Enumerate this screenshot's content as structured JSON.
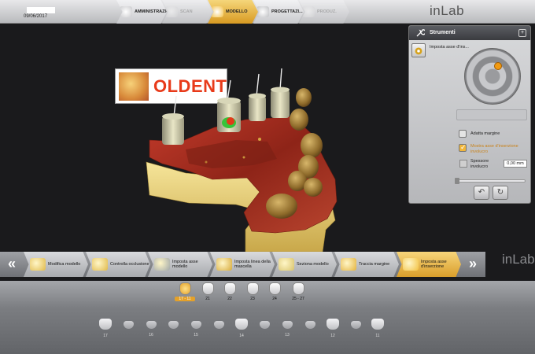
{
  "header": {
    "date": "09/06/2017",
    "brand": "inLab",
    "workflow": [
      {
        "label": "AMMINISTRAZIONE",
        "icon": "patient-record-icon",
        "state": "normal"
      },
      {
        "label": "SCAN",
        "icon": "scanner-icon",
        "state": "dim"
      },
      {
        "label": "MODELLO",
        "icon": "model-icon",
        "state": "active"
      },
      {
        "label": "PROGETTAZI...",
        "icon": "design-icon",
        "state": "normal"
      },
      {
        "label": "PRODUZ.",
        "icon": "milling-icon",
        "state": "dim"
      }
    ]
  },
  "scene": {
    "logo_text": "OLDENT"
  },
  "tools_panel": {
    "title": "Strumenti",
    "close_label": "+",
    "active_tool": "Imposta asse d'ins...",
    "disabled_button": "",
    "options": {
      "adapt_margin": {
        "label": "Adatta margine",
        "checked": false
      },
      "show_insertion_axis": {
        "label": "Mostra asse d'inserzione involucro",
        "checked": true
      }
    },
    "thickness_label": "Spessore involucro",
    "thickness_value": "0,00 mm",
    "undo_symbol": "↶",
    "redo_symbol": "↻"
  },
  "step_bar": {
    "prev": "«",
    "next": "»",
    "brand": "inLab",
    "steps": [
      {
        "label": "Modifica modello",
        "icon": "edit-model-icon",
        "active": false
      },
      {
        "label": "Controlla occlusione",
        "icon": "occlusion-icon",
        "active": false
      },
      {
        "label": "Imposta asse modello",
        "icon": "model-axis-icon",
        "active": false
      },
      {
        "label": "Imposta linea della mascella",
        "icon": "jaw-line-icon",
        "active": false
      },
      {
        "label": "Seziona modello",
        "icon": "section-model-icon",
        "active": false
      },
      {
        "label": "Traccia margine",
        "icon": "trace-margin-icon",
        "active": false
      },
      {
        "label": "Imposta asse d'inserzione",
        "icon": "insertion-axis-icon",
        "active": true
      }
    ]
  },
  "tooth_bar": [
    {
      "label": "17 - 11",
      "selected": true
    },
    {
      "label": "21",
      "selected": false
    },
    {
      "label": "22",
      "selected": false
    },
    {
      "label": "23",
      "selected": false
    },
    {
      "label": "24",
      "selected": false
    },
    {
      "label": "25 - 27",
      "selected": false
    }
  ],
  "arch_teeth": [
    {
      "label": "17",
      "type": "crown"
    },
    {
      "label": "",
      "type": "link"
    },
    {
      "label": "16",
      "type": "link"
    },
    {
      "label": "",
      "type": "link"
    },
    {
      "label": "15",
      "type": "link"
    },
    {
      "label": "",
      "type": "link"
    },
    {
      "label": "14",
      "type": "crown"
    },
    {
      "label": "",
      "type": "link"
    },
    {
      "label": "13",
      "type": "link"
    },
    {
      "label": "",
      "type": "link"
    },
    {
      "label": "12",
      "type": "crown"
    },
    {
      "label": "",
      "type": "link"
    },
    {
      "label": "11",
      "type": "crown"
    }
  ]
}
